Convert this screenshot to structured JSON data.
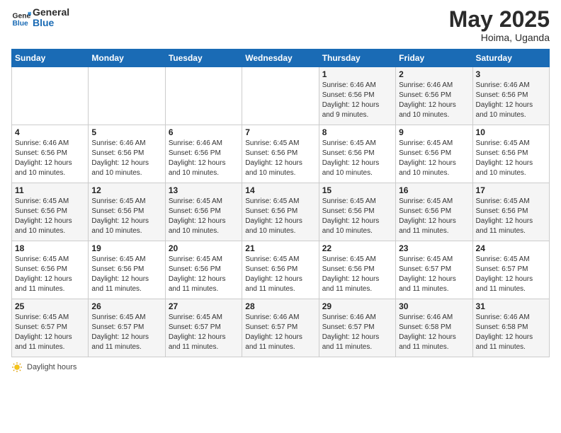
{
  "header": {
    "logo_general": "General",
    "logo_blue": "Blue",
    "month_title": "May 2025",
    "location": "Hoima, Uganda"
  },
  "weekdays": [
    "Sunday",
    "Monday",
    "Tuesday",
    "Wednesday",
    "Thursday",
    "Friday",
    "Saturday"
  ],
  "footer": {
    "daylight_label": "Daylight hours"
  },
  "weeks": [
    [
      {
        "day": "",
        "info": ""
      },
      {
        "day": "",
        "info": ""
      },
      {
        "day": "",
        "info": ""
      },
      {
        "day": "",
        "info": ""
      },
      {
        "day": "1",
        "info": "Sunrise: 6:46 AM\nSunset: 6:56 PM\nDaylight: 12 hours\nand 9 minutes."
      },
      {
        "day": "2",
        "info": "Sunrise: 6:46 AM\nSunset: 6:56 PM\nDaylight: 12 hours\nand 10 minutes."
      },
      {
        "day": "3",
        "info": "Sunrise: 6:46 AM\nSunset: 6:56 PM\nDaylight: 12 hours\nand 10 minutes."
      }
    ],
    [
      {
        "day": "4",
        "info": "Sunrise: 6:46 AM\nSunset: 6:56 PM\nDaylight: 12 hours\nand 10 minutes."
      },
      {
        "day": "5",
        "info": "Sunrise: 6:46 AM\nSunset: 6:56 PM\nDaylight: 12 hours\nand 10 minutes."
      },
      {
        "day": "6",
        "info": "Sunrise: 6:46 AM\nSunset: 6:56 PM\nDaylight: 12 hours\nand 10 minutes."
      },
      {
        "day": "7",
        "info": "Sunrise: 6:45 AM\nSunset: 6:56 PM\nDaylight: 12 hours\nand 10 minutes."
      },
      {
        "day": "8",
        "info": "Sunrise: 6:45 AM\nSunset: 6:56 PM\nDaylight: 12 hours\nand 10 minutes."
      },
      {
        "day": "9",
        "info": "Sunrise: 6:45 AM\nSunset: 6:56 PM\nDaylight: 12 hours\nand 10 minutes."
      },
      {
        "day": "10",
        "info": "Sunrise: 6:45 AM\nSunset: 6:56 PM\nDaylight: 12 hours\nand 10 minutes."
      }
    ],
    [
      {
        "day": "11",
        "info": "Sunrise: 6:45 AM\nSunset: 6:56 PM\nDaylight: 12 hours\nand 10 minutes."
      },
      {
        "day": "12",
        "info": "Sunrise: 6:45 AM\nSunset: 6:56 PM\nDaylight: 12 hours\nand 10 minutes."
      },
      {
        "day": "13",
        "info": "Sunrise: 6:45 AM\nSunset: 6:56 PM\nDaylight: 12 hours\nand 10 minutes."
      },
      {
        "day": "14",
        "info": "Sunrise: 6:45 AM\nSunset: 6:56 PM\nDaylight: 12 hours\nand 10 minutes."
      },
      {
        "day": "15",
        "info": "Sunrise: 6:45 AM\nSunset: 6:56 PM\nDaylight: 12 hours\nand 10 minutes."
      },
      {
        "day": "16",
        "info": "Sunrise: 6:45 AM\nSunset: 6:56 PM\nDaylight: 12 hours\nand 11 minutes."
      },
      {
        "day": "17",
        "info": "Sunrise: 6:45 AM\nSunset: 6:56 PM\nDaylight: 12 hours\nand 11 minutes."
      }
    ],
    [
      {
        "day": "18",
        "info": "Sunrise: 6:45 AM\nSunset: 6:56 PM\nDaylight: 12 hours\nand 11 minutes."
      },
      {
        "day": "19",
        "info": "Sunrise: 6:45 AM\nSunset: 6:56 PM\nDaylight: 12 hours\nand 11 minutes."
      },
      {
        "day": "20",
        "info": "Sunrise: 6:45 AM\nSunset: 6:56 PM\nDaylight: 12 hours\nand 11 minutes."
      },
      {
        "day": "21",
        "info": "Sunrise: 6:45 AM\nSunset: 6:56 PM\nDaylight: 12 hours\nand 11 minutes."
      },
      {
        "day": "22",
        "info": "Sunrise: 6:45 AM\nSunset: 6:56 PM\nDaylight: 12 hours\nand 11 minutes."
      },
      {
        "day": "23",
        "info": "Sunrise: 6:45 AM\nSunset: 6:57 PM\nDaylight: 12 hours\nand 11 minutes."
      },
      {
        "day": "24",
        "info": "Sunrise: 6:45 AM\nSunset: 6:57 PM\nDaylight: 12 hours\nand 11 minutes."
      }
    ],
    [
      {
        "day": "25",
        "info": "Sunrise: 6:45 AM\nSunset: 6:57 PM\nDaylight: 12 hours\nand 11 minutes."
      },
      {
        "day": "26",
        "info": "Sunrise: 6:45 AM\nSunset: 6:57 PM\nDaylight: 12 hours\nand 11 minutes."
      },
      {
        "day": "27",
        "info": "Sunrise: 6:45 AM\nSunset: 6:57 PM\nDaylight: 12 hours\nand 11 minutes."
      },
      {
        "day": "28",
        "info": "Sunrise: 6:46 AM\nSunset: 6:57 PM\nDaylight: 12 hours\nand 11 minutes."
      },
      {
        "day": "29",
        "info": "Sunrise: 6:46 AM\nSunset: 6:57 PM\nDaylight: 12 hours\nand 11 minutes."
      },
      {
        "day": "30",
        "info": "Sunrise: 6:46 AM\nSunset: 6:58 PM\nDaylight: 12 hours\nand 11 minutes."
      },
      {
        "day": "31",
        "info": "Sunrise: 6:46 AM\nSunset: 6:58 PM\nDaylight: 12 hours\nand 11 minutes."
      }
    ]
  ]
}
